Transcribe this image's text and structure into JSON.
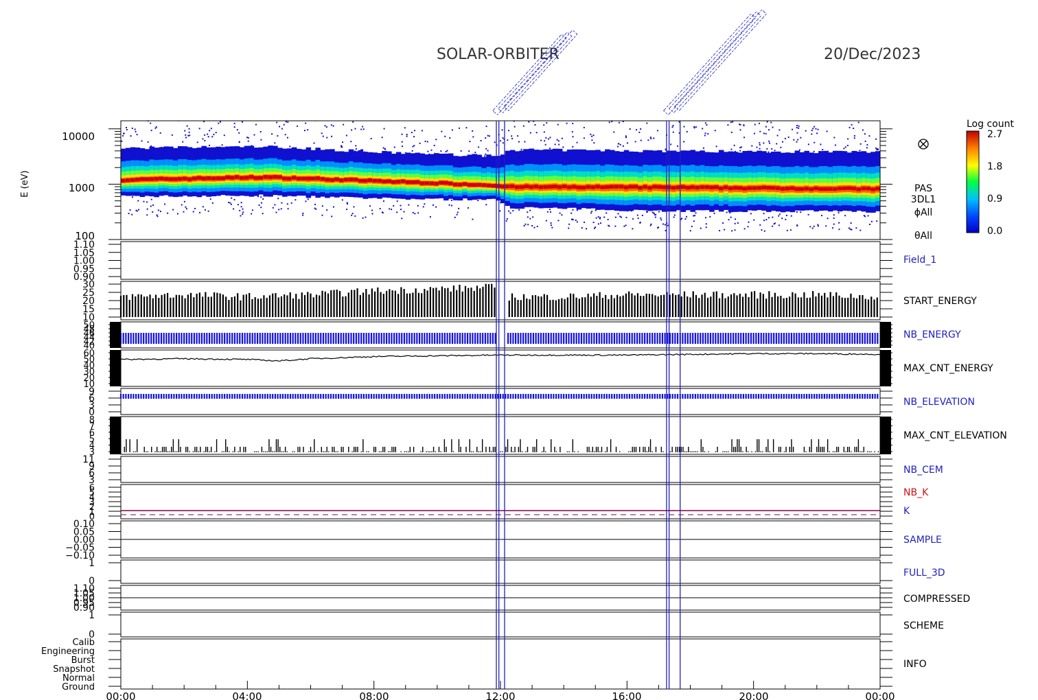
{
  "header": {
    "mission": "SOLAR-ORBITER",
    "date": "20/Dec/2023"
  },
  "colors": {
    "axis": "#000000",
    "marker": "#2020c0",
    "blue_trace": "#1010e0",
    "nb_k_label": "#d01010",
    "k_line": "#800040"
  },
  "time_axis": {
    "range_hours": [
      0,
      24
    ],
    "tick_labels": [
      "00:00",
      "04:00",
      "08:00",
      "12:00",
      "16:00",
      "20:00",
      "00:00"
    ]
  },
  "colorbar": {
    "title": "Log count",
    "ticks": [
      "2.7",
      "1.8",
      "0.9",
      "0.0"
    ],
    "range": [
      0.0,
      2.7
    ]
  },
  "markers": {
    "times_hours": [
      11.87,
      11.95,
      12.13,
      17.25,
      17.33,
      17.68
    ],
    "annotation_times": [
      12.0,
      17.4
    ]
  },
  "spectrogram": {
    "ylabel": "E (eV)",
    "y_ticks": [
      "10000",
      "1000",
      "100"
    ],
    "ylim": [
      100,
      14000
    ],
    "side_labels": [
      "PAS",
      "3DL1",
      "ϕAll",
      "θAll"
    ],
    "sensor_icon": "circle-x-icon",
    "ridge_keV": [
      {
        "t": 0,
        "peak": 1200,
        "low": 600,
        "high": 4500
      },
      {
        "t": 4.5,
        "peak": 1350,
        "low": 620,
        "high": 4800
      },
      {
        "t": 8,
        "peak": 1150,
        "low": 550,
        "high": 3800
      },
      {
        "t": 11.9,
        "peak": 950,
        "low": 520,
        "high": 3200
      },
      {
        "t": 12.2,
        "peak": 900,
        "low": 380,
        "high": 4200
      },
      {
        "t": 17,
        "peak": 880,
        "low": 330,
        "high": 4000
      },
      {
        "t": 24,
        "peak": 820,
        "low": 320,
        "high": 3800
      }
    ]
  },
  "chart_data": [
    {
      "type": "line",
      "name": "Field_1",
      "y_ticks": [
        "1.10",
        "1.05",
        "1.00",
        "0.95",
        "0.90"
      ],
      "ylim": [
        0.9,
        1.1
      ],
      "values": []
    },
    {
      "type": "bar",
      "name": "START_ENERGY",
      "y_ticks": [
        "30",
        "25",
        "20",
        "15",
        "10"
      ],
      "ylim": [
        10,
        30
      ],
      "x": [
        0,
        2,
        4,
        6,
        8,
        10,
        11.9,
        12.2,
        14,
        16,
        18,
        20,
        22,
        24
      ],
      "values": [
        22,
        23,
        22,
        23,
        25,
        26,
        27,
        22,
        22,
        23,
        23,
        23,
        23,
        22
      ]
    },
    {
      "type": "bar",
      "name": "NB_ENERGY",
      "y_ticks": [
        "50",
        "48",
        "46",
        "44",
        "42",
        "40"
      ],
      "ylim": [
        40,
        50
      ],
      "x": [
        0,
        24
      ],
      "values": [
        48,
        48
      ]
    },
    {
      "type": "line",
      "name": "MAX_CNT_ENERGY",
      "y_ticks": [
        "60",
        "50",
        "40",
        "30",
        "20",
        "10"
      ],
      "ylim": [
        10,
        60
      ],
      "x": [
        0,
        2,
        4,
        5,
        6,
        8,
        10,
        12,
        14,
        16,
        18,
        20,
        22,
        24
      ],
      "values": [
        47,
        48,
        47,
        45,
        48,
        51,
        52,
        53,
        53,
        53,
        54,
        55,
        55,
        54
      ]
    },
    {
      "type": "bar",
      "name": "NB_ELEVATION",
      "y_ticks": [
        "9",
        "6",
        "3",
        "0"
      ],
      "ylim": [
        0,
        10
      ],
      "x": [
        0,
        24
      ],
      "values": [
        9,
        9
      ]
    },
    {
      "type": "bar",
      "name": "MAX_CNT_ELEVATION",
      "y_ticks": [
        "8",
        "7",
        "6",
        "5",
        "4",
        "3"
      ],
      "ylim": [
        3,
        8
      ],
      "x": [
        0.1,
        0.6,
        1.0,
        1.8,
        2.3,
        3.5,
        4.7,
        6.0,
        7.3,
        8.5,
        9.1,
        10.4,
        11.5,
        13.0,
        14.2,
        15.5,
        16.8,
        18.2,
        20.5,
        22.5,
        23.2
      ],
      "values": [
        4,
        5,
        4,
        4,
        4,
        4,
        5,
        4,
        4,
        4,
        5,
        4,
        4,
        4,
        4,
        4,
        4,
        4,
        4,
        4,
        4
      ]
    },
    {
      "type": "line",
      "name": "NB_CEM",
      "y_ticks": [
        "11",
        "9",
        "6",
        "3"
      ],
      "ylim": [
        0,
        11
      ],
      "values": []
    },
    {
      "type": "line",
      "name": "NB_K / K",
      "labels": [
        "NB_K",
        "K"
      ],
      "y_ticks": [
        "6",
        "5",
        "4",
        "3",
        "2",
        "1",
        "0"
      ],
      "ylim": [
        0,
        6
      ],
      "series": [
        {
          "name": "NB_K",
          "x": [
            0,
            24
          ],
          "values": [
            1,
            1
          ]
        },
        {
          "name": "K",
          "x": [
            0,
            24
          ],
          "values": [
            0,
            0
          ]
        }
      ]
    },
    {
      "type": "line",
      "name": "SAMPLE",
      "y_ticks": [
        "0.10",
        "0.05",
        "0.00",
        "−0.05",
        "−0.10"
      ],
      "ylim": [
        -0.1,
        0.1
      ],
      "values": []
    },
    {
      "type": "line",
      "name": "FULL_3D",
      "y_ticks": [
        "1",
        "0"
      ],
      "ylim": [
        0,
        1
      ],
      "values": []
    },
    {
      "type": "line",
      "name": "COMPRESSED",
      "y_ticks": [
        "1.10",
        "1.05",
        "1.00",
        "0.95",
        "0.90"
      ],
      "ylim": [
        0.9,
        1.1
      ],
      "values": []
    },
    {
      "type": "line",
      "name": "SCHEME",
      "y_ticks": [
        "1",
        "0"
      ],
      "ylim": [
        0,
        1
      ],
      "values": []
    },
    {
      "type": "line",
      "name": "INFO",
      "y_ticks": [
        "Calib",
        "Engineering",
        "Burst",
        "Snapshot",
        "Normal",
        "Ground"
      ],
      "values": []
    }
  ]
}
